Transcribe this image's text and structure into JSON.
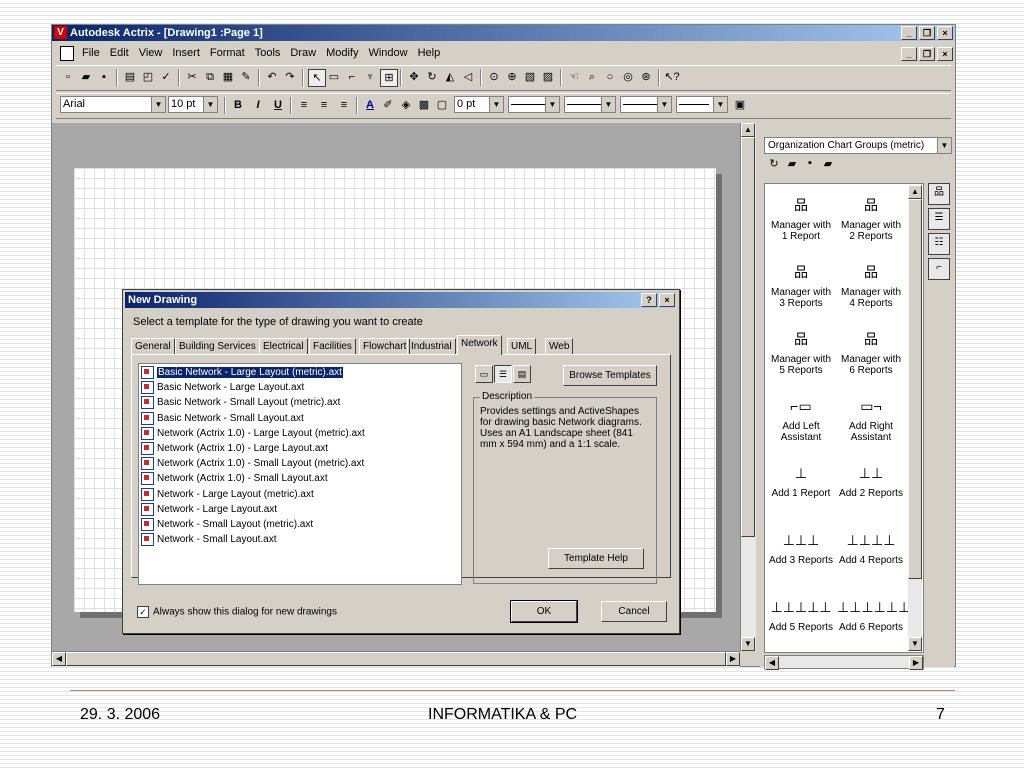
{
  "window": {
    "title": "Autodesk Actrix - [Drawing1 :Page 1]",
    "buttons": [
      "_",
      "❐",
      "×"
    ]
  },
  "menu": [
    "File",
    "Edit",
    "View",
    "Insert",
    "Format",
    "Tools",
    "Draw",
    "Modify",
    "Window",
    "Help"
  ],
  "format_bar": {
    "font": "Arial",
    "size": "10 pt",
    "bold": "B",
    "italic": "I",
    "underline": "U",
    "line_weight": "0 pt"
  },
  "dialog": {
    "title": "New Drawing",
    "help_btn": "?",
    "close_btn": "×",
    "prompt": "Select a template for the type of drawing you want to create",
    "tabs": [
      "General",
      "Building Services",
      "Electrical",
      "Facilities",
      "Flowchart",
      "Industrial",
      "Network",
      "UML",
      "Web"
    ],
    "active_tab": "Network",
    "templates": [
      "Basic Network - Large Layout (metric).axt",
      "Basic Network - Large Layout.axt",
      "Basic Network - Small Layout (metric).axt",
      "Basic Network - Small Layout.axt",
      "Network (Actrix 1.0) - Large Layout (metric).axt",
      "Network (Actrix 1.0) - Large Layout.axt",
      "Network (Actrix 1.0) - Small Layout (metric).axt",
      "Network (Actrix 1.0) - Small Layout.axt",
      "Network - Large Layout (metric).axt",
      "Network - Large Layout.axt",
      "Network - Small Layout (metric).axt",
      "Network - Small Layout.axt"
    ],
    "selected_index": 0,
    "browse_button": "Browse Templates",
    "description_label": "Description",
    "description_text": "Provides settings and ActiveShapes for drawing basic Network diagrams. Uses an A1 Landscape sheet (841 mm x 594 mm) and a 1:1 scale.",
    "template_help_button": "Template Help",
    "always_show_label": "Always show this dialog for new drawings",
    "always_show_checked": true,
    "ok_button": "OK",
    "cancel_button": "Cancel"
  },
  "panel": {
    "group_select": "Organization Chart Groups (metric)",
    "shapes": [
      {
        "label": "Manager with 1 Report"
      },
      {
        "label": "Manager with 2 Reports"
      },
      {
        "label": "Manager with 3 Reports"
      },
      {
        "label": "Manager with 4 Reports"
      },
      {
        "label": "Manager with 5 Reports"
      },
      {
        "label": "Manager with 6 Reports"
      },
      {
        "label": "Add Left Assistant"
      },
      {
        "label": "Add Right Assistant"
      },
      {
        "label": "Add 1 Report"
      },
      {
        "label": "Add 2 Reports"
      },
      {
        "label": "Add 3 Reports"
      },
      {
        "label": "Add 4 Reports"
      },
      {
        "label": "Add 5 Reports"
      },
      {
        "label": "Add 6 Reports"
      }
    ]
  },
  "footer": {
    "date": "29. 3. 2006",
    "title": "INFORMATIKA & PC",
    "page": "7"
  },
  "colors": {
    "titlebar": "#0a246a",
    "chrome": "#d4d0c8",
    "selection": "#0a246a"
  }
}
